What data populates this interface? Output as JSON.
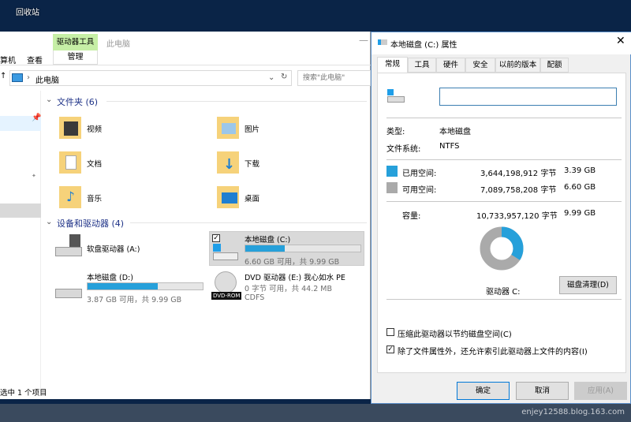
{
  "desktop": {
    "recycle_bin": "回收站",
    "watermark": "enjey12588.blog.163.com"
  },
  "explorer": {
    "ribbon": {
      "context_tab": "驱动器工具",
      "title": "此电脑",
      "tab_computer": "算机",
      "tab_view": "查看",
      "tab_manage": "管理"
    },
    "address": {
      "path": "此电脑",
      "search_placeholder": "搜索\"此电脑\""
    },
    "folders": {
      "header": "文件夹 (6)",
      "items": [
        {
          "label": "视频"
        },
        {
          "label": "图片"
        },
        {
          "label": "文档"
        },
        {
          "label": "下载"
        },
        {
          "label": "音乐"
        },
        {
          "label": "桌面"
        }
      ]
    },
    "devices": {
      "header": "设备和驱动器 (4)",
      "items": [
        {
          "label": "软盘驱动器 (A:)"
        },
        {
          "label": "本地磁盘 (C:)",
          "detail": "6.60 GB 可用，共 9.99 GB",
          "used_percent": 34
        },
        {
          "label": "本地磁盘 (D:)",
          "detail": "3.87 GB 可用，共 9.99 GB",
          "used_percent": 61
        },
        {
          "label": "DVD 驱动器 (E:) 我心如水 PE",
          "detail": "0 字节 可用，共 44.2 MB",
          "fs": "CDFS",
          "badge": "DVD-ROM"
        }
      ]
    },
    "status": "选中 1 个项目"
  },
  "dialog": {
    "title": "本地磁盘 (C:) 属性",
    "tabs": [
      "常规",
      "工具",
      "硬件",
      "安全",
      "以前的版本",
      "配额"
    ],
    "name_value": "",
    "type_label": "类型:",
    "type_value": "本地磁盘",
    "fs_label": "文件系统:",
    "fs_value": "NTFS",
    "used_label": "已用空间:",
    "used_bytes": "3,644,198,912 字节",
    "used_gb": "3.39 GB",
    "free_label": "可用空间:",
    "free_bytes": "7,089,758,208 字节",
    "free_gb": "6.60 GB",
    "cap_label": "容量:",
    "cap_bytes": "10,733,957,120 字节",
    "cap_gb": "9.99 GB",
    "used_fraction": 0.34,
    "drive_label": "驱动器 C:",
    "cleanup": "磁盘清理(D)",
    "compress": "压缩此驱动器以节约磁盘空间(C)",
    "compress_checked": false,
    "index": "除了文件属性外，还允许索引此驱动器上文件的内容(I)",
    "index_checked": true,
    "ok": "确定",
    "cancel": "取消",
    "apply": "应用(A)",
    "colors": {
      "used": "#26a0da",
      "free": "#aaaaaa"
    }
  }
}
